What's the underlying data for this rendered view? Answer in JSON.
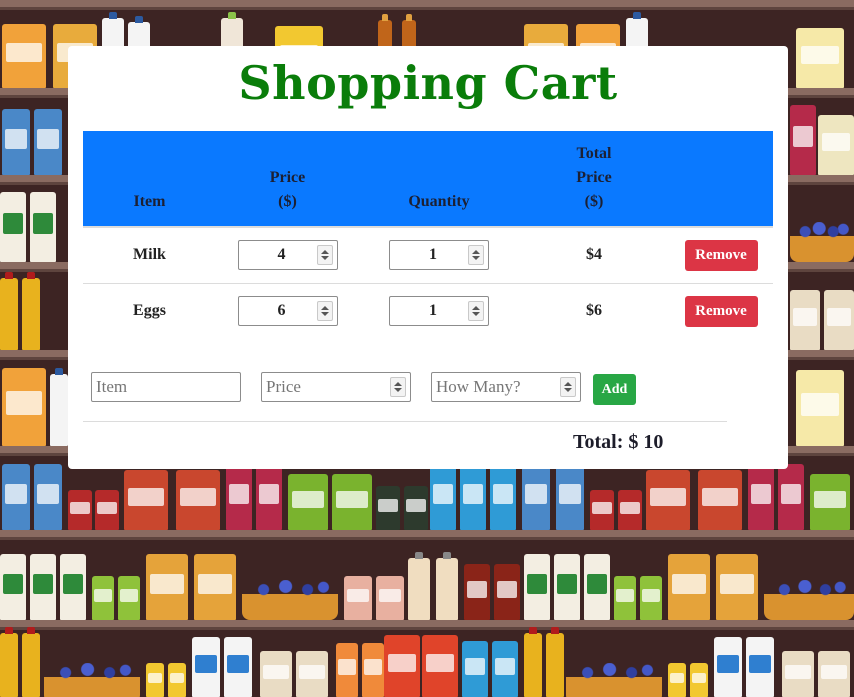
{
  "page": {
    "title": "Shopping Cart"
  },
  "table": {
    "headers": {
      "item": "Item",
      "price": [
        "Price",
        "($)"
      ],
      "quantity": "Quantity",
      "total": [
        "Total",
        "Price",
        "($)"
      ]
    },
    "rows": [
      {
        "item": "Milk",
        "price": "4",
        "quantity": "1",
        "total": "$4",
        "action": "Remove"
      },
      {
        "item": "Eggs",
        "price": "6",
        "quantity": "1",
        "total": "$6",
        "action": "Remove"
      }
    ]
  },
  "add_form": {
    "item_placeholder": "Item",
    "price_placeholder": "Price",
    "quantity_placeholder": "How Many?",
    "add_label": "Add"
  },
  "summary": {
    "total_label": "Total: $ 10"
  },
  "colors": {
    "title": "#0a7d0a",
    "header_bg": "#0a79ff",
    "remove_button": "#dc3545",
    "add_button": "#28a745",
    "background": "#3d2423"
  },
  "icons": [
    "spinner-up-icon",
    "spinner-down-icon"
  ]
}
